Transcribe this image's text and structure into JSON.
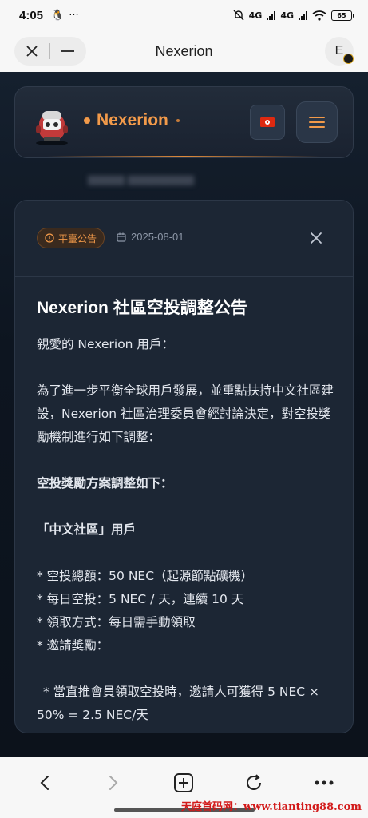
{
  "status_bar": {
    "time": "4:05",
    "network_label": "4G",
    "battery": "65"
  },
  "browser": {
    "title": "Nexerion",
    "extension_letter": "E"
  },
  "site": {
    "brand": "Nexerion",
    "accent_color": "#f29a4a"
  },
  "announcement": {
    "tag": "平臺公告",
    "date": "2025-08-01",
    "title": "Nexerion 社區空投調整公告",
    "greeting": "親愛的 Nexerion 用戶：",
    "intro": "為了進一步平衡全球用戶發展，並重點扶持中文社區建設，Nexerion 社區治理委員會經討論決定，對空投獎勵機制進行如下調整：",
    "section_title": "空投獎勵方案調整如下：",
    "group_title": "「中文社區」用戶",
    "items": [
      "* 空投總額：50 NEC（起源節點礦機）",
      "* 每日空投：5 NEC / 天，連續 10 天",
      "* 領取方式：每日需手動領取",
      "* 邀請獎勵："
    ],
    "sub_item": "* 當直推會員領取空投時，邀請人可獲得 5 NEC × 50% = 2.5 NEC/天"
  },
  "watermark": "天庭首码网：www.tianting88.com"
}
